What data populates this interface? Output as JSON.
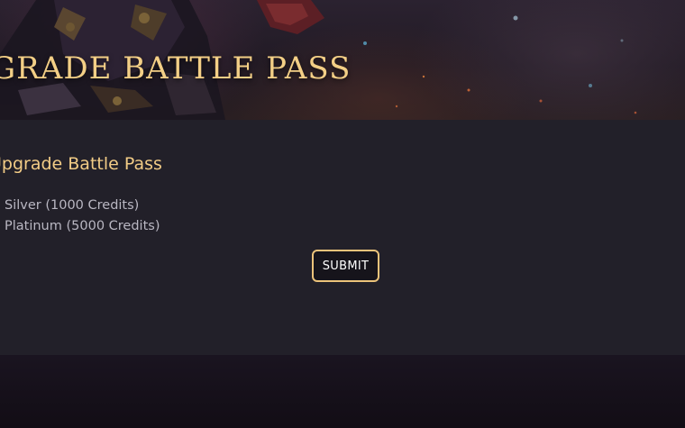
{
  "hero": {
    "title": "GRADE BATTLE PASS"
  },
  "form": {
    "heading": "Upgrade Battle Pass",
    "options": [
      {
        "label": "Silver (1000 Credits)",
        "selected": false
      },
      {
        "label": "Platinum (5000 Credits)",
        "selected": false
      }
    ],
    "submit_label": "SUBMIT"
  },
  "colors": {
    "accent_gold": "#f2cc86",
    "panel_bg": "#222029",
    "page_bg": "#140f18"
  }
}
